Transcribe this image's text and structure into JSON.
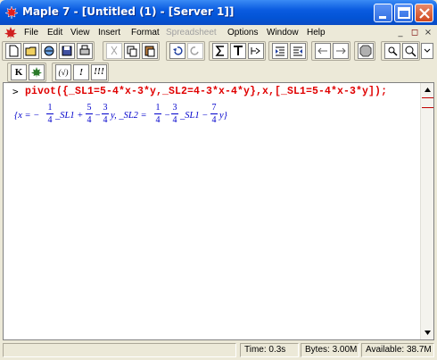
{
  "window": {
    "title": "Maple 7  - [Untitled (1) - [Server 1]]",
    "colors": {
      "titlebar": "#0a5be0",
      "input": "#e00000",
      "output": "#0000cc"
    }
  },
  "window_controls": {
    "minimize": "minimize-icon",
    "maximize": "maximize-icon",
    "close": "close-icon"
  },
  "menubar": {
    "items": [
      {
        "label": "File"
      },
      {
        "label": "Edit"
      },
      {
        "label": "View"
      },
      {
        "label": "Insert"
      },
      {
        "label": "Format"
      },
      {
        "label": "Spreadsheet",
        "disabled": true
      },
      {
        "label": "Options"
      },
      {
        "label": "Window"
      },
      {
        "label": "Help"
      }
    ],
    "doc_controls": [
      "_",
      "×"
    ]
  },
  "context_toolbar": {
    "buttons": [
      "K",
      "(√)",
      "!",
      "!!!"
    ]
  },
  "worksheet": {
    "prompt": ">",
    "input": "pivot({_SL1=5-4*x-3*y,_SL2=4-3*x-4*y},x,[_SL1=5-4*x-3*y]);",
    "output": {
      "p1": "{x = −",
      "f1n": "1",
      "f1d": "4",
      "p2": "_SL1 +",
      "f2n": "5",
      "f2d": "4",
      "p3": "−",
      "f3n": "3",
      "f3d": "4",
      "p4": "y, _SL2 =",
      "f4n": "1",
      "f4d": "4",
      "p5": "−",
      "f5n": "3",
      "f5d": "4",
      "p6": "_SL1 −",
      "f6n": "7",
      "f6d": "4",
      "p7": "y}"
    }
  },
  "statusbar": {
    "time": "Time: 0.3s",
    "bytes": "Bytes: 3.00M",
    "available": "Available: 38.7M"
  }
}
